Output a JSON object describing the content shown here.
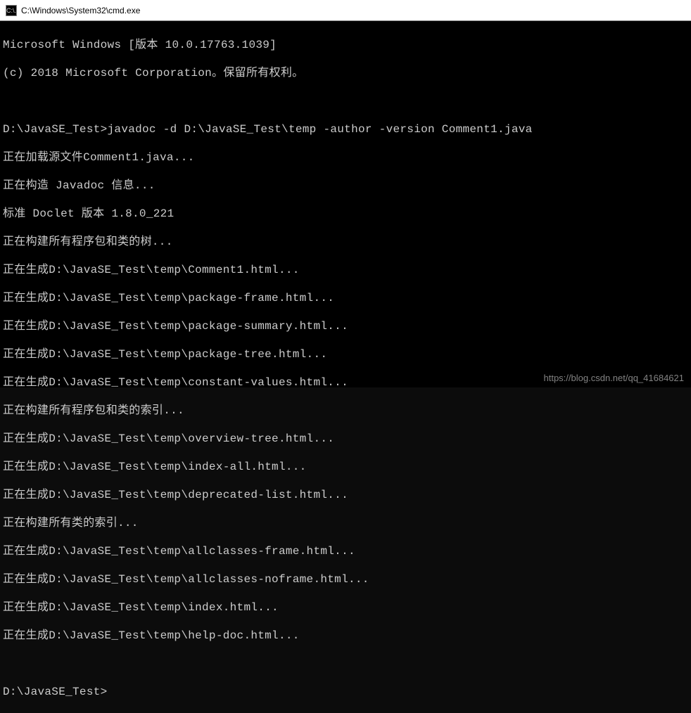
{
  "window": {
    "icon_label": "C:\\.",
    "title": "C:\\Windows\\System32\\cmd.exe"
  },
  "terminal": {
    "lines": [
      "Microsoft Windows [版本 10.0.17763.1039]",
      "(c) 2018 Microsoft Corporation。保留所有权利。",
      "",
      "D:\\JavaSE_Test>javadoc -d D:\\JavaSE_Test\\temp -author -version Comment1.java",
      "正在加载源文件Comment1.java...",
      "正在构造 Javadoc 信息...",
      "标准 Doclet 版本 1.8.0_221",
      "正在构建所有程序包和类的树...",
      "正在生成D:\\JavaSE_Test\\temp\\Comment1.html...",
      "正在生成D:\\JavaSE_Test\\temp\\package-frame.html...",
      "正在生成D:\\JavaSE_Test\\temp\\package-summary.html...",
      "正在生成D:\\JavaSE_Test\\temp\\package-tree.html...",
      "正在生成D:\\JavaSE_Test\\temp\\constant-values.html...",
      "正在构建所有程序包和类的索引...",
      "正在生成D:\\JavaSE_Test\\temp\\overview-tree.html...",
      "正在生成D:\\JavaSE_Test\\temp\\index-all.html...",
      "正在生成D:\\JavaSE_Test\\temp\\deprecated-list.html...",
      "正在构建所有类的索引...",
      "正在生成D:\\JavaSE_Test\\temp\\allclasses-frame.html...",
      "正在生成D:\\JavaSE_Test\\temp\\allclasses-noframe.html...",
      "正在生成D:\\JavaSE_Test\\temp\\index.html...",
      "正在生成D:\\JavaSE_Test\\temp\\help-doc.html...",
      "",
      "D:\\JavaSE_Test>"
    ]
  },
  "watermark": "https://blog.csdn.net/qq_41684621"
}
